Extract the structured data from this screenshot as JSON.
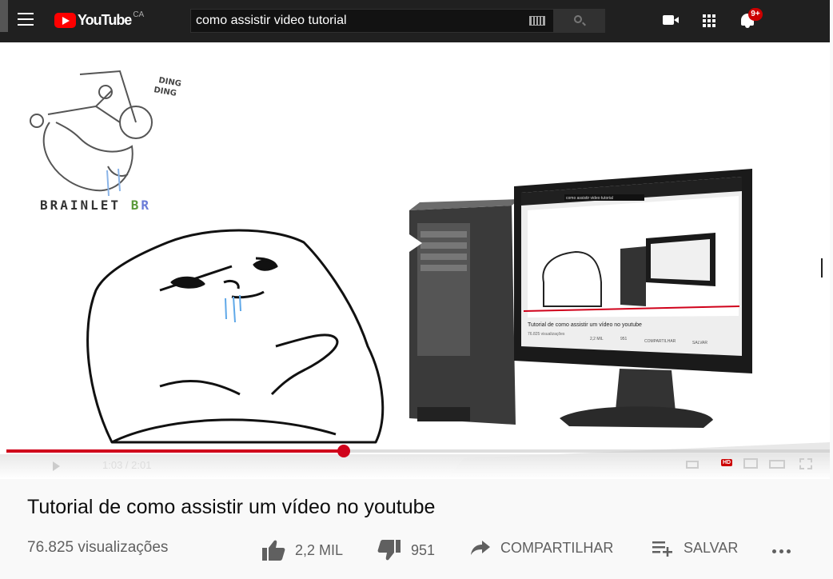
{
  "header": {
    "logo_text": "YouTube",
    "region": "CA",
    "search_value": "como assistir video tutorial",
    "notifications_badge": "9+"
  },
  "player": {
    "progress_fraction": 0.41,
    "time_label": "1:03 / 2:01",
    "watermark": {
      "word": "BRAINLET",
      "suffix_b": "B",
      "suffix_r": "R"
    }
  },
  "video": {
    "title": "Tutorial de como assistir um vídeo no youtube",
    "views": "76.825 visualizações",
    "like_label": "2,2 MIL",
    "dislike_label": "951",
    "share_label": "COMPARTILHAR",
    "save_label": "SALVAR"
  },
  "inner_screen": {
    "search_value": "como assistir video tutorial",
    "title": "Tutorial de como assistir um vídeo no youtube",
    "views": "76.825 visualizações",
    "like_label": "2,2 MIL",
    "dislike_label": "951",
    "share_label": "COMPARTILHAR",
    "save_label": "SALVAR"
  },
  "colors": {
    "brand_red": "#ff0000",
    "progress_red": "#d0021b",
    "topbar": "#202020"
  }
}
